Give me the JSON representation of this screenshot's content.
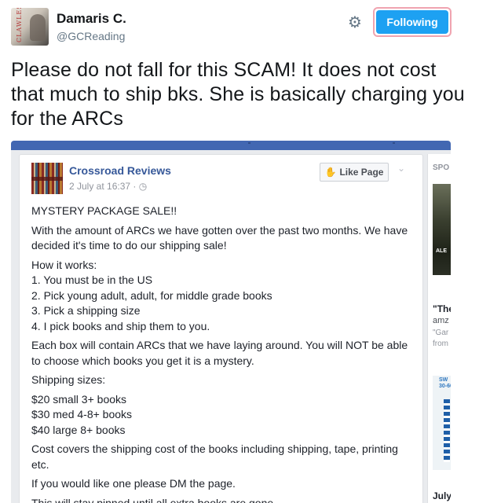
{
  "tweet": {
    "author": {
      "display_name": "Damaris C.",
      "handle": "@GCReading",
      "avatar_text": "CLAWLESS"
    },
    "follow_button_label": "Following",
    "text": "Please do not fall for this SCAM! It does not cost that much to ship bks. She is basically charging you for the ARCs"
  },
  "facebook_post": {
    "page_name": "Crossroad Reviews",
    "meta": "2 July at 16:37 · ◷",
    "like_button_label": "Like Page",
    "paragraphs": [
      "MYSTERY PACKAGE SALE!!",
      "With the amount of ARCs we have gotten over the past two months. We have decided it's time to do our shipping sale!",
      "How it works:",
      "1. You must be in the US",
      "2. Pick young adult, adult, for middle grade books",
      "3. Pick a shipping size",
      "4. I pick books and ship them to you.",
      "Each box will contain ARCs that we have laying around. You will NOT be able to choose which books you get it is a mystery.",
      "Shipping sizes:",
      "$20 small 3+ books",
      "$30 med 4-8+ books",
      "$40 large 8+ books",
      "Cost covers the shipping cost of the books including shipping, tape, printing etc.",
      "If you would like one please DM the page.",
      "This will stay pinned until all extra books are gone."
    ]
  },
  "sidebar": {
    "label": "SPO",
    "ad1_tag": "ALE",
    "title": "\"The",
    "line1": "amz",
    "line2": "\"Gar",
    "line3": "from",
    "ad2_promo": "SW\n30-60",
    "date": "July"
  },
  "colors": {
    "follow_blue": "#1da1f2",
    "facebook_blue": "#4267b2",
    "link_blue": "#365899"
  }
}
